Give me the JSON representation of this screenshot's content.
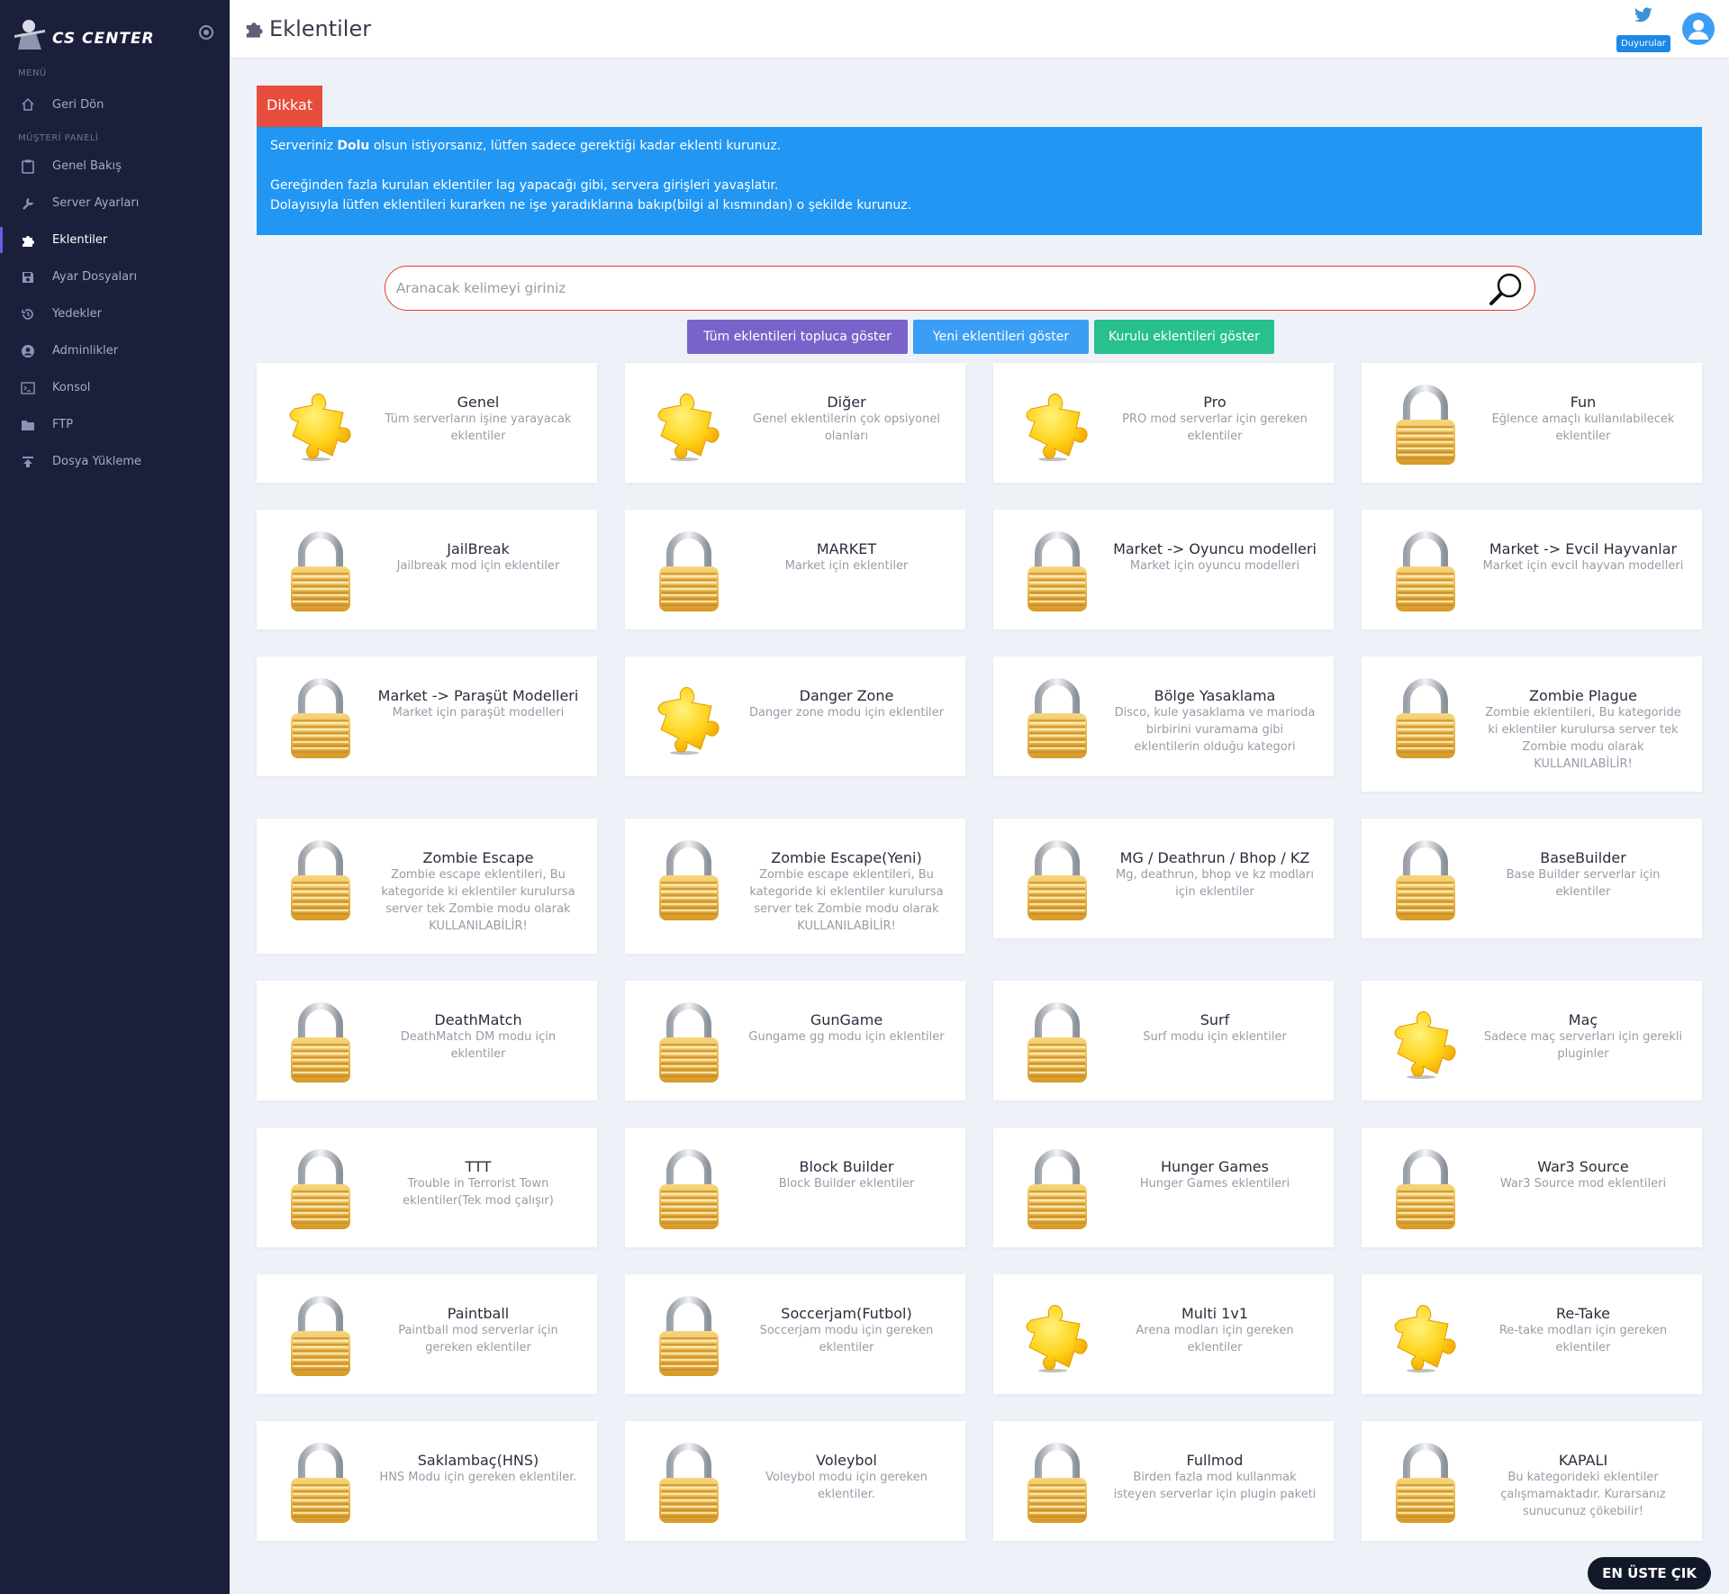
{
  "brand": {
    "name": "CS CENTER"
  },
  "sidebar": {
    "sections": [
      {
        "header": "MENÜ",
        "items": [
          {
            "label": "Geri Dön",
            "icon": "home-icon"
          }
        ]
      },
      {
        "header": "MÜŞTERİ PANELİ",
        "items": [
          {
            "label": "Genel Bakış",
            "icon": "clipboard-icon"
          },
          {
            "label": "Server Ayarları",
            "icon": "wrench-icon"
          },
          {
            "label": "Eklentiler",
            "icon": "puzzle-icon",
            "active": true
          },
          {
            "label": "Ayar Dosyaları",
            "icon": "save-icon"
          },
          {
            "label": "Yedekler",
            "icon": "history-icon"
          },
          {
            "label": "Adminlikler",
            "icon": "user-circle-icon"
          },
          {
            "label": "Konsol",
            "icon": "terminal-icon"
          },
          {
            "label": "FTP",
            "icon": "folder-icon"
          },
          {
            "label": "Dosya Yükleme",
            "icon": "upload-icon"
          }
        ]
      }
    ]
  },
  "header": {
    "title": "Eklentiler",
    "announcements_label": "Duyurular"
  },
  "alert": {
    "tag": "Dikkat",
    "line1_pre": "Serveriniz ",
    "line1_bold": "Dolu",
    "line1_post": " olsun istiyorsanız, lütfen sadece gerektiği kadar eklenti kurunuz.",
    "line2": "Gereğinden fazla kurulan eklentiler lag yapacağı gibi, servera girişleri yavaşlatır.",
    "line3": "Dolayısıyla lütfen eklentileri kurarken ne işe yaradıklarına bakıp(bilgi al kısmından) o şekilde kurunuz."
  },
  "search": {
    "placeholder": "Aranacak kelimeyi giriniz"
  },
  "filters": {
    "all": "Tüm eklentileri topluca göster",
    "new": "Yeni eklentileri göster",
    "installed": "Kurulu eklentileri göster"
  },
  "categories": [
    {
      "title": "Genel",
      "desc": "Tüm serverların işine yarayacak eklentiler",
      "icon": "puzzle"
    },
    {
      "title": "Diğer",
      "desc": "Genel eklentilerin çok opsiyonel olanları",
      "icon": "puzzle"
    },
    {
      "title": "Pro",
      "desc": "PRO mod serverlar için gereken eklentiler",
      "icon": "puzzle"
    },
    {
      "title": "Fun",
      "desc": "Eğlence amaçlı kullanılabilecek eklentiler",
      "icon": "lock"
    },
    {
      "title": "JailBreak",
      "desc": "Jailbreak mod için eklentiler",
      "icon": "lock"
    },
    {
      "title": "MARKET",
      "desc": "Market için eklentiler",
      "icon": "lock"
    },
    {
      "title": "Market -> Oyuncu modelleri",
      "desc": "Market için oyuncu modelleri",
      "icon": "lock"
    },
    {
      "title": "Market -> Evcil Hayvanlar",
      "desc": "Market için evcil hayvan modelleri",
      "icon": "lock"
    },
    {
      "title": "Market -> Paraşüt Modelleri",
      "desc": "Market için paraşüt modelleri",
      "icon": "lock"
    },
    {
      "title": "Danger Zone",
      "desc": "Danger zone modu için eklentiler",
      "icon": "puzzle"
    },
    {
      "title": "Bölge Yasaklama",
      "desc": "Disco, kule yasaklama ve marioda birbirini vuramama gibi eklentilerin olduğu kategori",
      "icon": "lock"
    },
    {
      "title": "Zombie Plague",
      "desc": "Zombie eklentileri, Bu kategoride ki eklentiler kurulursa server tek Zombie modu olarak KULLANILABİLİR!",
      "icon": "lock"
    },
    {
      "title": "Zombie Escape",
      "desc": "Zombie escape eklentileri, Bu kategoride ki eklentiler kurulursa server tek Zombie modu olarak KULLANILABİLİR!",
      "icon": "lock"
    },
    {
      "title": "Zombie Escape(Yeni)",
      "desc": "Zombie escape eklentileri, Bu kategoride ki eklentiler kurulursa server tek Zombie modu olarak KULLANILABİLİR!",
      "icon": "lock"
    },
    {
      "title": "MG / Deathrun / Bhop / KZ",
      "desc": "Mg, deathrun, bhop ve kz modları için eklentiler",
      "icon": "lock"
    },
    {
      "title": "BaseBuilder",
      "desc": "Base Builder serverlar için eklentiler",
      "icon": "lock"
    },
    {
      "title": "DeathMatch",
      "desc": "DeathMatch DM modu için eklentiler",
      "icon": "lock"
    },
    {
      "title": "GunGame",
      "desc": "Gungame gg modu için eklentiler",
      "icon": "lock"
    },
    {
      "title": "Surf",
      "desc": "Surf modu için eklentiler",
      "icon": "lock"
    },
    {
      "title": "Maç",
      "desc": "Sadece maç serverları için gerekli pluginler",
      "icon": "puzzle"
    },
    {
      "title": "TTT",
      "desc": "Trouble in Terrorist Town eklentiler(Tek mod çalışır)",
      "icon": "lock"
    },
    {
      "title": "Block Builder",
      "desc": "Block Builder eklentiler",
      "icon": "lock"
    },
    {
      "title": "Hunger Games",
      "desc": "Hunger Games eklentileri",
      "icon": "lock"
    },
    {
      "title": "War3 Source",
      "desc": "War3 Source mod eklentileri",
      "icon": "lock"
    },
    {
      "title": "Paintball",
      "desc": "Paintball mod serverlar için gereken eklentiler",
      "icon": "lock"
    },
    {
      "title": "Soccerjam(Futbol)",
      "desc": "Soccerjam modu için gereken eklentiler",
      "icon": "lock"
    },
    {
      "title": "Multi 1v1",
      "desc": "Arena modları için gereken eklentiler",
      "icon": "puzzle"
    },
    {
      "title": "Re-Take",
      "desc": "Re-take modları için gereken eklentiler",
      "icon": "puzzle"
    },
    {
      "title": "Saklambaç(HNS)",
      "desc": "HNS Modu için gereken eklentiler.",
      "icon": "lock"
    },
    {
      "title": "Voleybol",
      "desc": "Voleybol modu için gereken eklentiler.",
      "icon": "lock"
    },
    {
      "title": "Fullmod",
      "desc": "Birden fazla mod kullanmak isteyen serverlar için plugin paketi",
      "icon": "lock"
    },
    {
      "title": "KAPALI",
      "desc": "Bu kategorideki eklentiler çalışmamaktadır. Kurarsanız sunucunuz çökebilir!",
      "icon": "lock"
    }
  ],
  "scroll_top": "EN ÜSTE ÇIK",
  "colors": {
    "sidebar_bg": "#1b1f3b",
    "alert_tag": "#e74c3c",
    "alert_bg": "#2196f3",
    "filter_all": "#7a63c8",
    "filter_new": "#3b9ef5",
    "filter_installed": "#27c08e"
  }
}
